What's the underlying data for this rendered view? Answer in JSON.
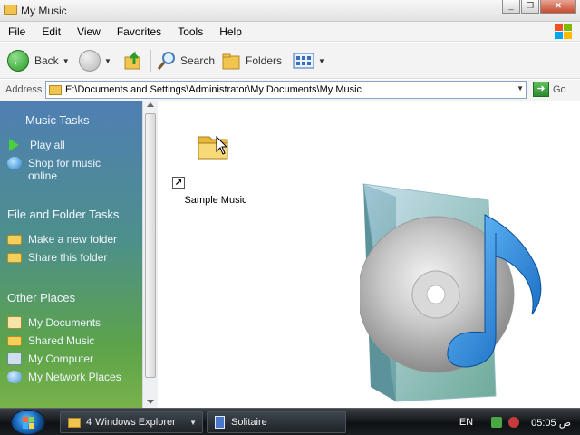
{
  "window": {
    "title": "My Music",
    "buttons": [
      "_",
      "❐",
      "✕"
    ]
  },
  "menu": [
    "File",
    "Edit",
    "View",
    "Favorites",
    "Tools",
    "Help"
  ],
  "toolbar": {
    "back_label": "Back",
    "search_label": "Search",
    "folders_label": "Folders"
  },
  "address": {
    "label": "Address",
    "path": "E:\\Documents and Settings\\Administrator\\My Documents\\My Music",
    "go_label": "Go"
  },
  "taskpane": {
    "music_tasks": {
      "header": "Music Tasks",
      "items": [
        "Play all",
        "Shop for music online"
      ]
    },
    "file_folder_tasks": {
      "header": "File and Folder Tasks",
      "items": [
        "Make a new folder",
        "Share this folder"
      ]
    },
    "other_places": {
      "header": "Other Places",
      "items": [
        "My Documents",
        "Shared Music",
        "My Computer",
        "My Network Places"
      ]
    }
  },
  "content": {
    "items": [
      {
        "label": "Sample Music",
        "icon": "folder-shortcut-icon"
      }
    ]
  },
  "taskbar": {
    "buttons": [
      {
        "count": "4",
        "label": "Windows Explorer"
      },
      {
        "label": "Solitaire"
      }
    ],
    "language": "EN",
    "clock": "05:05 ص"
  },
  "colors": {
    "taskpane_top": "#4f7fb3",
    "taskpane_bottom": "#78b24b",
    "taskbar": "#0f1215"
  }
}
